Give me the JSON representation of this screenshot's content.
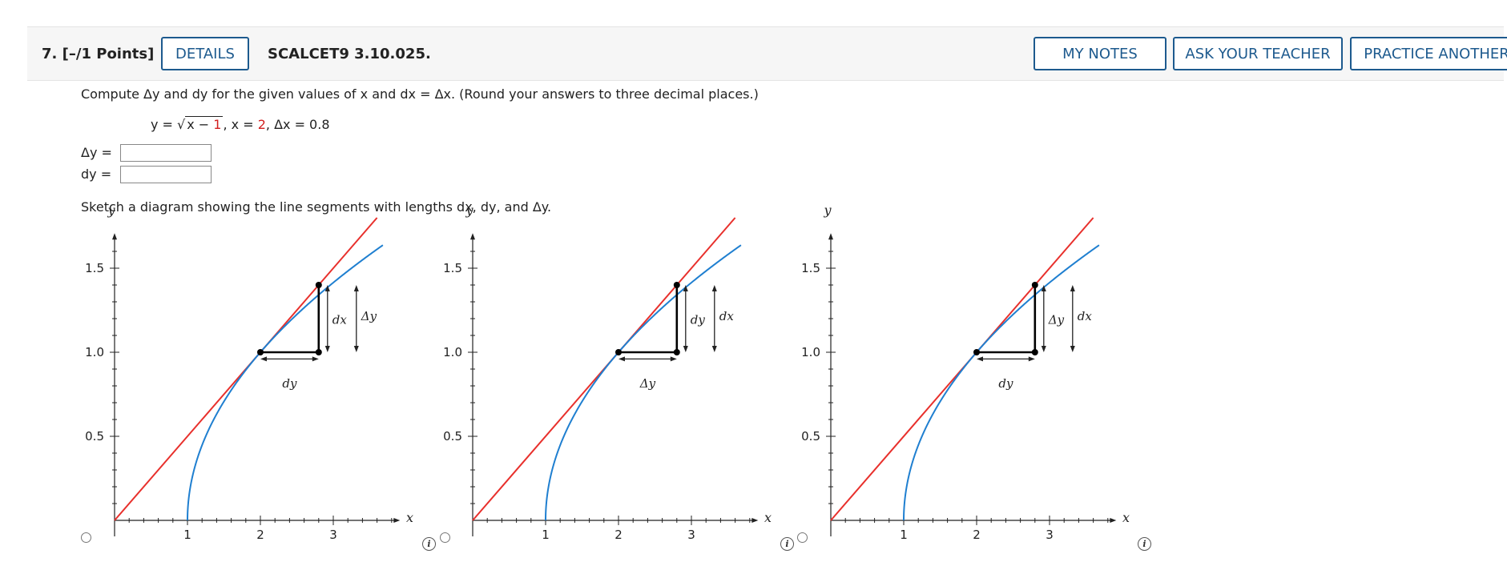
{
  "question": {
    "number": "7.",
    "points": "[–/1 Points]",
    "details_label": "DETAILS",
    "code": "SCALCET9 3.10.025.",
    "my_notes_label": "MY NOTES",
    "ask_teacher_label": "ASK YOUR TEACHER",
    "practice_label": "PRACTICE ANOTHER"
  },
  "prompt": "Compute Δy and dy for the given values of x and dx = Δx. (Round your answers to three decimal places.)",
  "equation": {
    "lhs": "y = √",
    "radicand_x": "x − ",
    "radicand_1": "1",
    "x_part": ",   x = ",
    "x_val": "2",
    "dx_part": ",   Δx = 0.8"
  },
  "answers": {
    "delta_y_label": "Δy  =",
    "dy_label": "dy  =",
    "delta_y_value": "",
    "dy_value": ""
  },
  "sketch_prompt": "Sketch a diagram showing the line segments with lengths dx, dy, and Δy.",
  "graphs": {
    "axis_x_label": "x",
    "axis_y_label": "y",
    "x_ticks": [
      "1",
      "2",
      "3"
    ],
    "y_ticks": [
      "0.5",
      "1.0",
      "1.5"
    ],
    "curve_color": "#1f7fd0",
    "tangent_color": "#e8302c",
    "options": [
      {
        "seg_label_bottom": "dy",
        "seg_label_inner": "dx",
        "seg_label_outer": "Δy"
      },
      {
        "seg_label_bottom": "Δy",
        "seg_label_inner": "dy",
        "seg_label_outer": "dx"
      },
      {
        "seg_label_bottom": "dy",
        "seg_label_inner": "Δy",
        "seg_label_outer": "dx"
      }
    ],
    "info_icon_glyph": "i"
  }
}
